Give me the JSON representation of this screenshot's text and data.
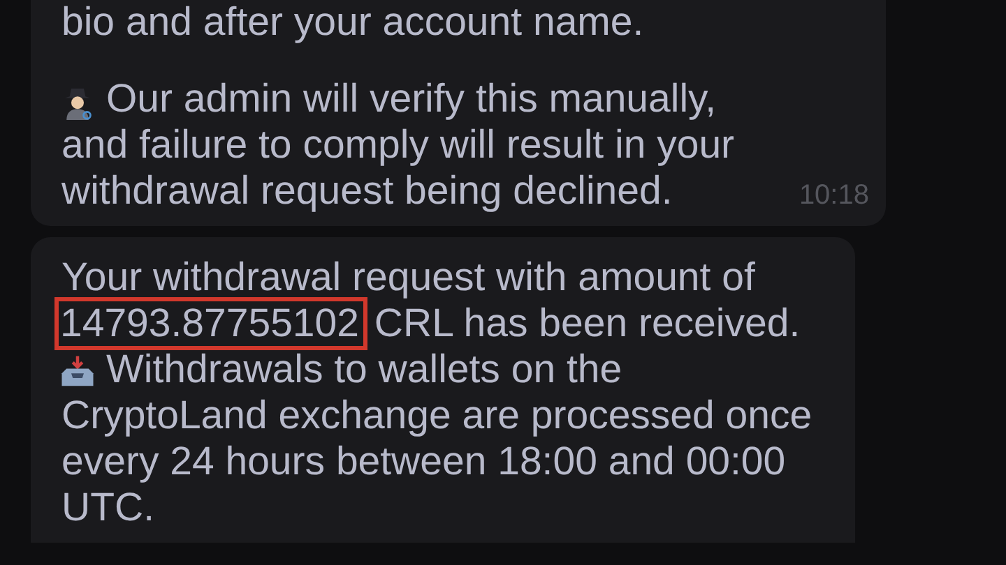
{
  "messages": [
    {
      "paragraphs": [
        {
          "lines": [
            "bio and after your account name."
          ]
        },
        {
          "lines": [
            "Our admin will verify this manually,",
            "and failure to comply will result in your",
            "withdrawal request being declined."
          ]
        }
      ],
      "time": "10:18"
    },
    {
      "highlight": {
        "before": "Your withdrawal request with amount of",
        "marked": "14793.87755102",
        "after": "CRL has been received."
      },
      "paragraphs": [
        {
          "lines": [
            "Withdrawals to wallets on the",
            "CryptoLand exchange are processed once",
            "every 24 hours between 18:00 and 00:00",
            "UTC."
          ]
        }
      ]
    }
  ]
}
